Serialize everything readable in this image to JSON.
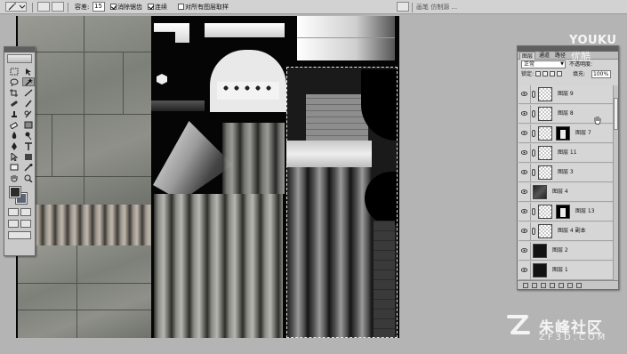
{
  "options_bar": {
    "tolerance_label": "容差:",
    "tolerance_value": "15",
    "anti_alias_label": "消除锯齿",
    "contiguous_label": "连续",
    "sample_all_label": "对所有图层取样",
    "panel_tabs": "画笔  仿制源  ..."
  },
  "layers_panel": {
    "tabs": [
      "图层",
      "通道",
      "路径"
    ],
    "blend_mode": "正常",
    "opacity_label": "不透明度:",
    "lock_label": "锁定:",
    "fill_label": "填充:",
    "fill_value": "100%",
    "layers": [
      {
        "name": "图层 9",
        "thumb": "trans",
        "mask": false,
        "link": true
      },
      {
        "name": "图层 8",
        "thumb": "trans",
        "mask": false,
        "link": true
      },
      {
        "name": "图层 7",
        "thumb": "trans",
        "mask": true,
        "link": true
      },
      {
        "name": "图层 11",
        "thumb": "trans",
        "mask": false,
        "link": true
      },
      {
        "name": "图层 3",
        "thumb": "trans",
        "mask": false,
        "link": true
      },
      {
        "name": "图层 4",
        "thumb": "img",
        "mask": false,
        "link": false
      },
      {
        "name": "图层 13",
        "thumb": "trans",
        "mask": true,
        "link": true
      },
      {
        "name": "图层 4 副本",
        "thumb": "trans",
        "mask": false,
        "link": true
      },
      {
        "name": "图层 2",
        "thumb": "dark",
        "mask": false,
        "link": false
      },
      {
        "name": "图层 1",
        "thumb": "dark",
        "mask": false,
        "link": false
      }
    ]
  },
  "watermarks": {
    "youku": "YOUKU",
    "youku_sub": "优酷",
    "site_cn": "朱峰社区",
    "site_en": "ZF3D.COM"
  },
  "colors": {
    "foreground": "#2c2c2c",
    "background": "#5c6576"
  }
}
